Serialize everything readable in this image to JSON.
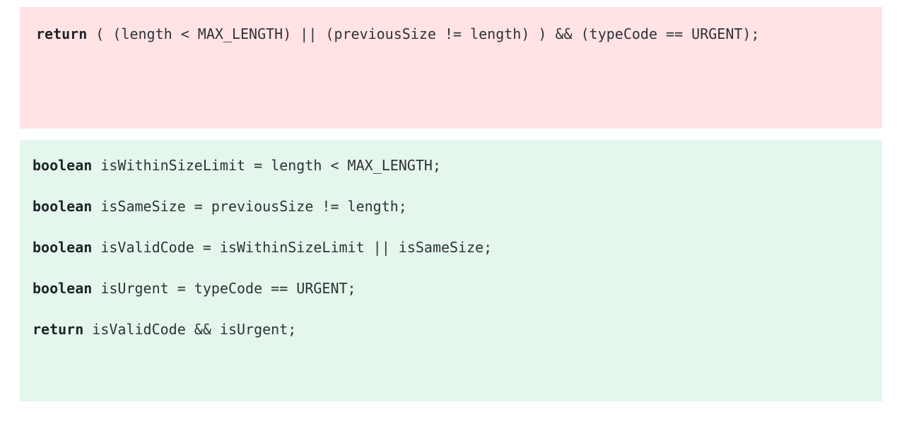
{
  "bad_example": {
    "lines": [
      {
        "keyword": "return",
        "text": " ( (length < MAX_LENGTH) || (previousSize != length) ) && (typeCode == URGENT);"
      }
    ]
  },
  "good_example": {
    "lines": [
      {
        "keyword": "boolean",
        "text": " isWithinSizeLimit = length < MAX_LENGTH;"
      },
      {
        "keyword": "boolean",
        "text": " isSameSize = previousSize != length;"
      },
      {
        "keyword": "boolean",
        "text": " isValidCode = isWithinSizeLimit || isSameSize;"
      },
      {
        "keyword": "boolean",
        "text": " isUrgent = typeCode == URGENT;"
      },
      {
        "keyword": "return",
        "text": " isValidCode && isUrgent;"
      }
    ]
  },
  "colors": {
    "bad_background": "#ffe3e5",
    "good_background": "#e5f6ec"
  }
}
